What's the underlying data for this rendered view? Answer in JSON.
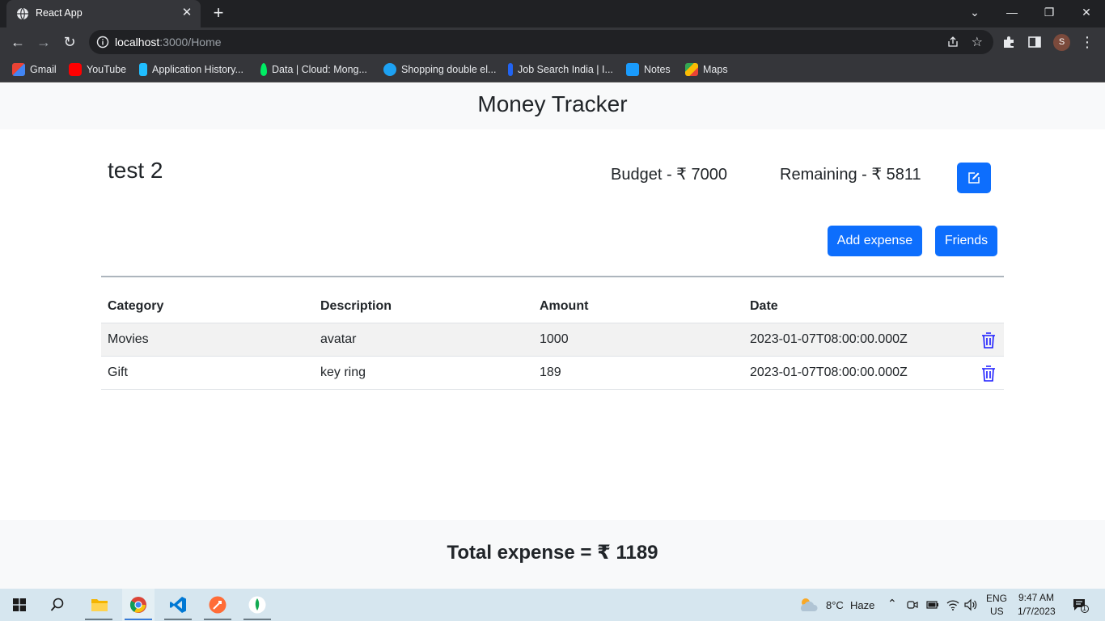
{
  "browser": {
    "tab_title": "React App",
    "tab_close": "✕",
    "new_tab": "+",
    "url_host": "localhost",
    "url_rest": ":3000/Home",
    "bookmarks": [
      {
        "label": "Gmail",
        "icon": "gmail-icon",
        "color": "#ea4335"
      },
      {
        "label": "YouTube",
        "icon": "youtube-icon",
        "color": "#ff0000"
      },
      {
        "label": "Application History...",
        "icon": "kaggle-icon",
        "color": "#20beff"
      },
      {
        "label": "Data | Cloud: Mong...",
        "icon": "mongodb-icon",
        "color": "#00ed64"
      },
      {
        "label": "Shopping double el...",
        "icon": "shopping-icon",
        "color": "#1da1f2"
      },
      {
        "label": "Job Search India | I...",
        "icon": "indeed-icon",
        "color": "#2164f3"
      },
      {
        "label": "Notes",
        "icon": "notes-icon",
        "color": "#1a9bfc"
      },
      {
        "label": "Maps",
        "icon": "maps-icon",
        "color": "#34a853"
      }
    ],
    "profile_initial": "S"
  },
  "app": {
    "brand": "Money Tracker",
    "tracker_name": "test 2",
    "budget": "Budget - ₹ 7000",
    "remaining": "Remaining - ₹ 5811",
    "add_expense": "Add expense",
    "friends": "Friends",
    "table": {
      "headers": [
        "Category",
        "Description",
        "Amount",
        "Date"
      ],
      "rows": [
        {
          "category": "Movies",
          "description": "avatar",
          "amount": "1000",
          "date": "2023-01-07T08:00:00.000Z"
        },
        {
          "category": "Gift",
          "description": "key ring",
          "amount": "189",
          "date": "2023-01-07T08:00:00.000Z"
        }
      ]
    },
    "total": "Total expense = ₹ 1189",
    "accent_color": "#0d6efd",
    "delete_color": "#1a1aff"
  },
  "taskbar": {
    "weather_temp": "8°C",
    "weather_desc": "Haze",
    "lang_top": "ENG",
    "lang_bottom": "US",
    "time": "9:47 AM",
    "date": "1/7/2023",
    "notification_count": "1"
  }
}
